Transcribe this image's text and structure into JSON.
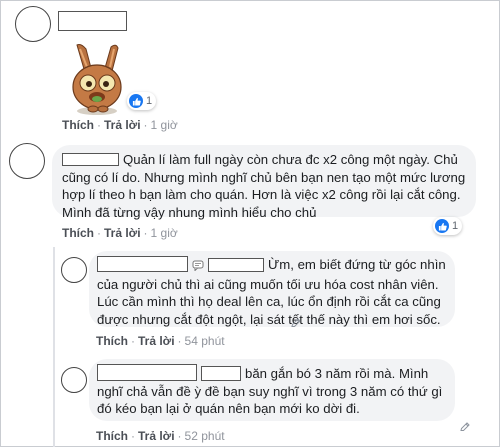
{
  "comments": [
    {
      "actions": {
        "like": "Thích",
        "reply": "Trả lời",
        "time": "1 giờ"
      },
      "reaction_count": "1"
    },
    {
      "text": "Quản lí làm full ngày còn chưa đc x2 công một ngày. Chủ cũng có lí do. Nhưng mình nghĩ chủ bên bạn nen tạo một mức lương hợp lí theo h bạn làm cho quán. Hơn là việc x2 công rồi lại cắt công. Mình đã từng vậy nhung mình hiểu cho chủ",
      "actions": {
        "like": "Thích",
        "reply": "Trả lời",
        "time": "1 giờ"
      },
      "reaction_count": "1"
    },
    {
      "text": "Ừm, em biết đứng từ góc nhìn của người chủ thì ai cũng muốn tối ưu hóa cost nhân viên. Lúc cần mình thì họ deal lên ca, lúc ổn định rồi cắt ca cũng được nhưng cắt đột ngột, lại sát tết thế này thì em hơi sốc.",
      "actions": {
        "like": "Thích",
        "reply": "Trả lời",
        "time": "54 phút"
      }
    },
    {
      "text": "băn gắn bó 3 năm rồi mà. Mình nghĩ chả vẫn đề ỳ đề bạn suy nghĩ vì trong 3 năm có thứ gì đó kéo bạn lại ở quán nên bạn mới ko dời đi.",
      "actions": {
        "like": "Thích",
        "reply": "Trả lời",
        "time": "52 phút"
      }
    }
  ],
  "colors": {
    "like_blue": "#1877f2",
    "bubble_bg": "#f2f3f5",
    "link_gray": "#606770"
  },
  "icons": [
    "like-icon",
    "sticker",
    "chat-bubble-icon",
    "edit-pencil-icon"
  ]
}
